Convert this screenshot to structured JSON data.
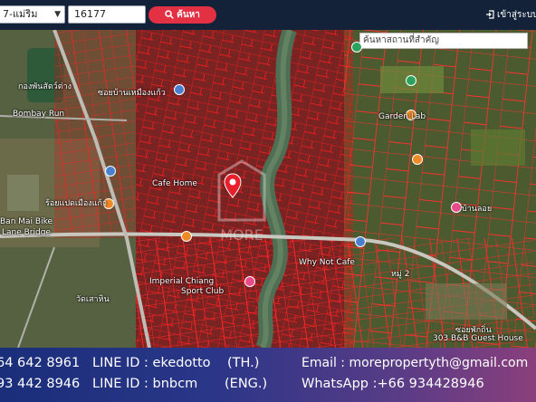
{
  "topbar": {
    "district_select": "7-แม่ริม",
    "parcel_input": "16177",
    "search_button": "ค้นหา",
    "login_link": "เข้าสู่ระบบ/ล"
  },
  "map": {
    "place_search_placeholder": "ค้นหาสถานที่สำคัญ",
    "labels": {
      "l1": "กองพันสัตว์ต่าง",
      "l2": "Bombay Run",
      "l3": "ซอยบ้านเหมืองแก้ว",
      "l4": "Garden Lab",
      "l5": "Ban Mai Bike",
      "l6": "Lane Bridge",
      "l7": "Cafe Home",
      "l8": "Imperial Chiang",
      "l9": "Sport Club",
      "l10": "Why Not Cafe",
      "l11": "ร้อยแปดเมืองแก้ว",
      "l12": "วัดเสาหิน",
      "l13": "303 B&B Guest House",
      "l14": "ซอยพักถิ่น",
      "l15": "หมู่ 2",
      "l16": "บ้านลอย"
    },
    "watermark": "MORE"
  },
  "footer": {
    "phone1": "64 642 8961",
    "line1_label": "LINE ID : ekedotto",
    "line1_lang": "(TH.)",
    "phone2": "93 442 8946",
    "line2_label": "LINE ID : bnbcm",
    "line2_lang": "(ENG.)",
    "email": "Email : morepropertyth@gmail.com",
    "whatsapp": "WhatsApp :+66 934428946"
  },
  "colors": {
    "topbar": "#132238",
    "accent": "#e33042",
    "parcel_lines": "#ff2020"
  }
}
